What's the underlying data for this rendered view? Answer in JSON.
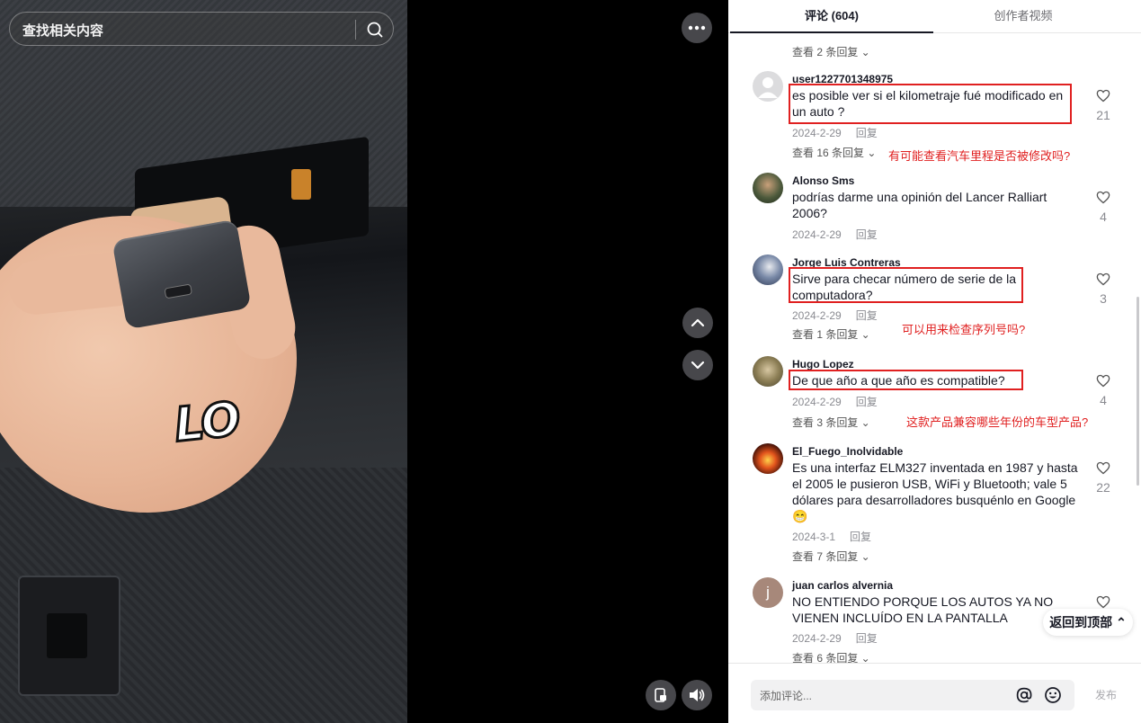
{
  "search": {
    "placeholder": "查找相关内容",
    "icon": "search-icon"
  },
  "video": {
    "caption": "LO"
  },
  "tabs": [
    {
      "label": "评论 (604)",
      "active": true
    },
    {
      "label": "创作者视频",
      "active": false
    }
  ],
  "partial_reply": "查看 2 条回复 ⌄",
  "comments": [
    {
      "user": "user1227701348975",
      "text": "es posible ver si el kilometraje fué modificado en un auto ?",
      "date": "2024-2-29",
      "reply_label": "回复",
      "likes": "21",
      "view_replies": "查看 16 条回复 ⌄",
      "annotation": "有可能查看汽车里程是否被修改吗?"
    },
    {
      "user": "Alonso Sms",
      "text": "podrías darme una opinión del Lancer Ralliart 2006?",
      "date": "2024-2-29",
      "reply_label": "回复",
      "likes": "4"
    },
    {
      "user": "Jorge Luis Contreras",
      "text": "Sirve para checar número de serie de la computadora?",
      "date": "2024-2-29",
      "reply_label": "回复",
      "likes": "3",
      "view_replies": "查看 1 条回复 ⌄",
      "annotation": "可以用来检查序列号吗?"
    },
    {
      "user": "Hugo Lopez",
      "text": "De que año a que año es compatible?",
      "date": "2024-2-29",
      "reply_label": "回复",
      "likes": "4",
      "view_replies": "查看 3 条回复 ⌄",
      "annotation": "这款产品兼容哪些年份的车型产品?"
    },
    {
      "user": "El_Fuego_Inolvidable",
      "text": "Es una interfaz ELM327 inventada en 1987 y hasta el 2005 le pusieron USB, WiFi y Bluetooth; vale 5 dólares para desarrolladores busquénlo en Google 😁",
      "date": "2024-3-1",
      "reply_label": "回复",
      "likes": "22",
      "view_replies": "查看 7 条回复 ⌄"
    },
    {
      "user": "juan carlos alvernia",
      "avatar_letter": "j",
      "text": "NO ENTIENDO PORQUE LOS AUTOS YA NO VIENEN INCLUÍDO EN LA PANTALLA",
      "date": "2024-2-29",
      "reply_label": "回复",
      "view_replies": "查看 6 条回复 ⌄"
    }
  ],
  "back_to_top": "返回到顶部 ⌃",
  "composer": {
    "placeholder": "添加评论...",
    "post_label": "发布"
  },
  "colors": {
    "annotation_red": "#e02020",
    "text_primary": "#161823",
    "meta_gray": "#8a8b91"
  }
}
